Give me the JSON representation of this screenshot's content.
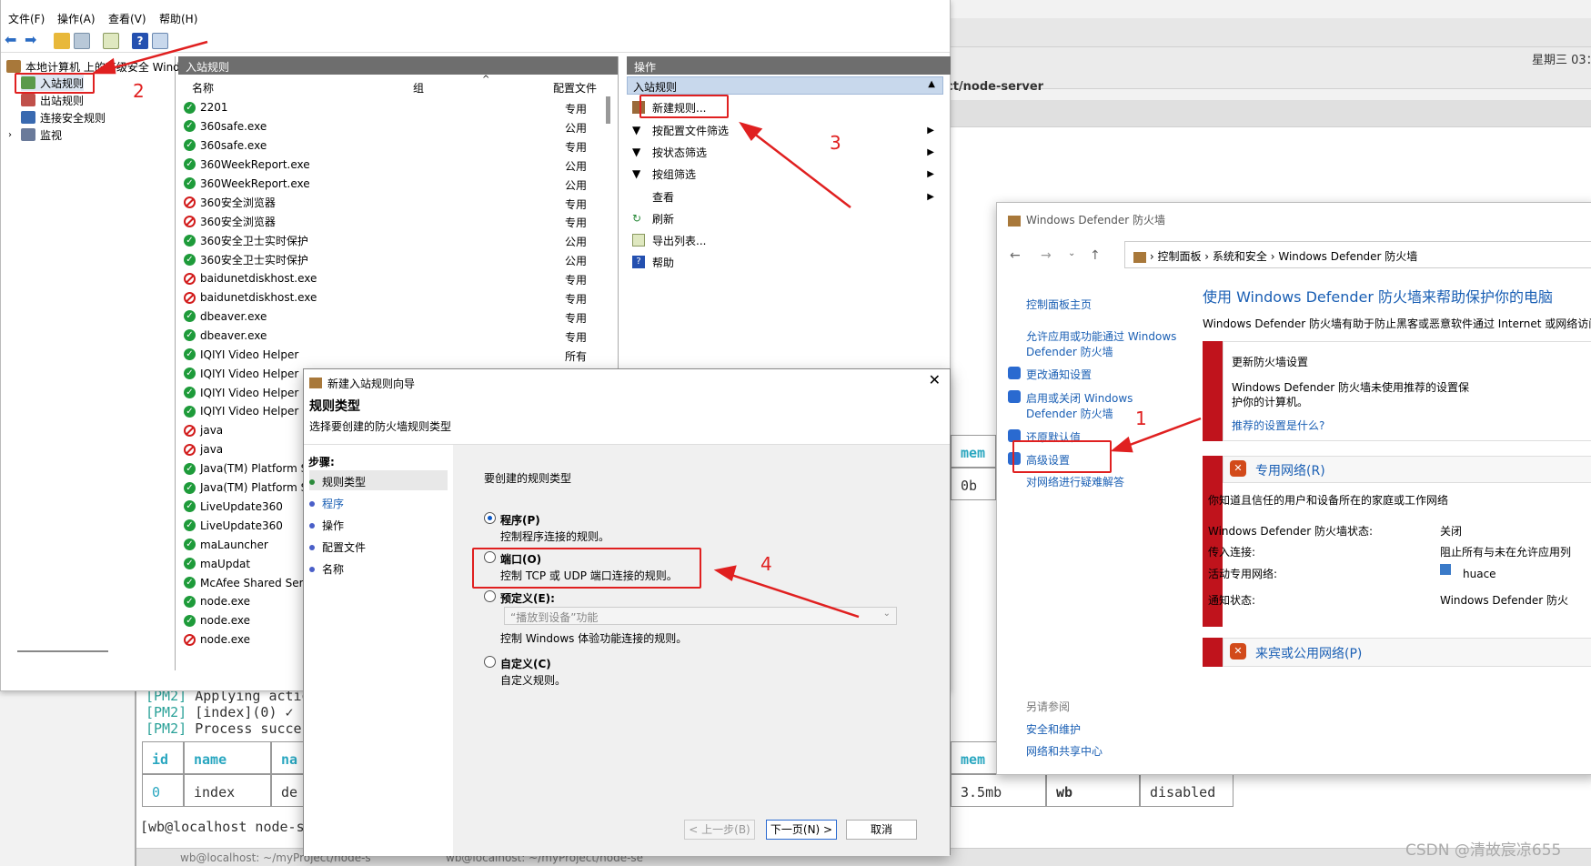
{
  "terminal": {
    "path_title": "ct/node-server",
    "date_time": "星期三 03：0",
    "pm2_lines": [
      {
        "tag": "[PM2]",
        "text": "Applying actio"
      },
      {
        "tag": "[PM2]",
        "text": "[index](0) ✓"
      },
      {
        "tag": "[PM2]",
        "text": "Process succes"
      }
    ],
    "table_headers": {
      "id": "id",
      "name": "name",
      "na": "na",
      "mem": "mem"
    },
    "row_upper": {
      "mem": "0b"
    },
    "row_lower": {
      "id": "0",
      "name": "index",
      "de": "de",
      "mem": "3.5mb",
      "user": "wb",
      "watch": "disabled"
    },
    "prompt": "[wb@localhost node-s",
    "tabs": [
      "wb@localhost: ~/myProject/node-s",
      "wb@localhost: ~/myProject/node-se"
    ]
  },
  "mmc": {
    "menu": [
      "文件(F)",
      "操作(A)",
      "查看(V)",
      "帮助(H)"
    ],
    "tree": {
      "root": "本地计算机 上的高级安全 Wind",
      "items": [
        "入站规则",
        "出站规则",
        "连接安全规则",
        "监视"
      ]
    },
    "list": {
      "title": "入站规则",
      "columns": {
        "name": "名称",
        "group": "组",
        "profile": "配置文件"
      },
      "rules": [
        {
          "name": "2201",
          "status": "allow",
          "profile": "专用"
        },
        {
          "name": "360safe.exe",
          "status": "allow",
          "profile": "公用"
        },
        {
          "name": "360safe.exe",
          "status": "allow",
          "profile": "专用"
        },
        {
          "name": "360WeekReport.exe",
          "status": "allow",
          "profile": "公用"
        },
        {
          "name": "360WeekReport.exe",
          "status": "allow",
          "profile": "公用"
        },
        {
          "name": "360安全浏览器",
          "status": "block",
          "profile": "专用"
        },
        {
          "name": "360安全浏览器",
          "status": "block",
          "profile": "专用"
        },
        {
          "name": "360安全卫士实时保护",
          "status": "allow",
          "profile": "公用"
        },
        {
          "name": "360安全卫士实时保护",
          "status": "allow",
          "profile": "公用"
        },
        {
          "name": "baidunetdiskhost.exe",
          "status": "block",
          "profile": "专用"
        },
        {
          "name": "baidunetdiskhost.exe",
          "status": "block",
          "profile": "专用"
        },
        {
          "name": "dbeaver.exe",
          "status": "allow",
          "profile": "专用"
        },
        {
          "name": "dbeaver.exe",
          "status": "allow",
          "profile": "专用"
        },
        {
          "name": "IQIYI Video Helper",
          "status": "allow",
          "profile": "所有"
        },
        {
          "name": "IQIYI Video Helper",
          "status": "allow",
          "profile": ""
        },
        {
          "name": "IQIYI Video Helper",
          "status": "allow",
          "profile": ""
        },
        {
          "name": "IQIYI Video Helper",
          "status": "allow",
          "profile": ""
        },
        {
          "name": "java",
          "status": "block",
          "profile": ""
        },
        {
          "name": "java",
          "status": "block",
          "profile": ""
        },
        {
          "name": "Java(TM) Platform S",
          "status": "allow",
          "profile": ""
        },
        {
          "name": "Java(TM) Platform S",
          "status": "allow",
          "profile": ""
        },
        {
          "name": "LiveUpdate360",
          "status": "allow",
          "profile": ""
        },
        {
          "name": "LiveUpdate360",
          "status": "allow",
          "profile": ""
        },
        {
          "name": "maLauncher",
          "status": "allow",
          "profile": ""
        },
        {
          "name": "maUpdat",
          "status": "allow",
          "profile": ""
        },
        {
          "name": "McAfee Shared Serv",
          "status": "allow",
          "profile": ""
        },
        {
          "name": "node.exe",
          "status": "allow",
          "profile": ""
        },
        {
          "name": "node.exe",
          "status": "allow",
          "profile": ""
        },
        {
          "name": "node.exe",
          "status": "block",
          "profile": ""
        }
      ]
    },
    "actions": {
      "title": "操作",
      "section": "入站规则",
      "items": [
        "新建规则...",
        "按配置文件筛选",
        "按状态筛选",
        "按组筛选",
        "查看",
        "刷新",
        "导出列表...",
        "帮助"
      ]
    }
  },
  "firewall": {
    "window_title": "Windows Defender 防火墙",
    "breadcrumb": [
      "控制面板",
      "系统和安全",
      "Windows Defender 防火墙"
    ],
    "left_links": [
      "控制面板主页",
      "允许应用或功能通过 Windows",
      "Defender 防火墙",
      "更改通知设置",
      "启用或关闭 Windows",
      "Defender 防火墙",
      "还原默认值",
      "高级设置",
      "对网络进行疑难解答"
    ],
    "see_also": {
      "title": "另请参阅",
      "links": [
        "安全和维护",
        "网络和共享中心"
      ]
    },
    "heading": "使用 Windows Defender 防火墙来帮助保护你的电脑",
    "description": "Windows Defender 防火墙有助于防止黑客或恶意软件通过 Internet 或网络访问",
    "update_box": {
      "title": "更新防火墙设置",
      "text1": "Windows Defender 防火墙未使用推荐的设置保",
      "text2": "护你的计算机。",
      "link": "推荐的设置是什么?"
    },
    "private": {
      "title": "专用网络(R)",
      "desc": "你知道且信任的用户和设备所在的家庭或工作网络",
      "rows": [
        {
          "label": "Windows Defender 防火墙状态:",
          "value": "关闭"
        },
        {
          "label": "传入连接:",
          "value": "阻止所有与未在允许应用列"
        },
        {
          "label": "活动专用网络:",
          "value": "huace"
        },
        {
          "label": "通知状态:",
          "value": "Windows Defender 防火"
        }
      ]
    },
    "public": {
      "title": "来宾或公用网络(P)"
    }
  },
  "wizard": {
    "title": "新建入站规则向导",
    "heading": "规则类型",
    "subheading": "选择要创建的防火墙规则类型",
    "steps_label": "步骤:",
    "steps": [
      "规则类型",
      "程序",
      "操作",
      "配置文件",
      "名称"
    ],
    "prompt": "要创建的规则类型",
    "options": [
      {
        "title": "程序(P)",
        "desc": "控制程序连接的规则。",
        "selected": true
      },
      {
        "title": "端口(O)",
        "desc": "控制 TCP 或 UDP 端口连接的规则。",
        "selected": false
      },
      {
        "title": "预定义(E):",
        "desc": "控制 Windows 体验功能连接的规则。",
        "selected": false
      },
      {
        "title": "自定义(C)",
        "desc": "自定义规则。",
        "selected": false
      }
    ],
    "predefined_select": "“播放到设备”功能",
    "buttons": {
      "back": "< 上一步(B)",
      "next": "下一页(N) >",
      "cancel": "取消"
    }
  },
  "annotations": [
    "1",
    "2",
    "3",
    "4"
  ],
  "watermark": "CSDN @清故宸凉655",
  "colors": {
    "annotation_red": "#e02020",
    "allow_green": "#1e9b3a",
    "block_red": "#d21c1c",
    "link_blue": "#1a5fb4",
    "panel_gray": "#6e6e6e"
  }
}
